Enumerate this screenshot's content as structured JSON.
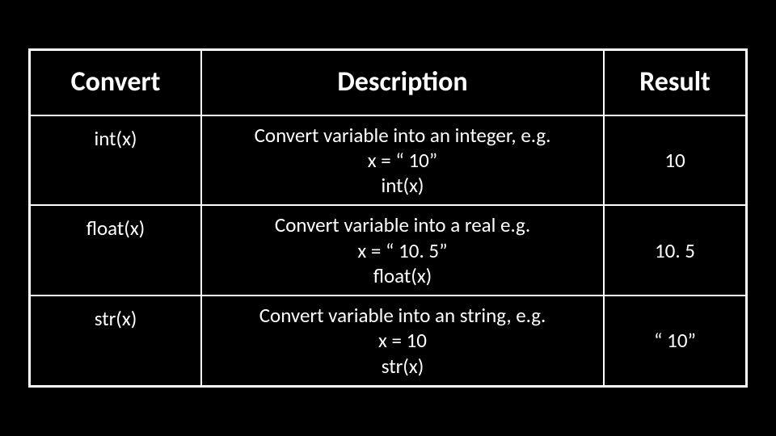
{
  "columns": {
    "convert": "Convert",
    "description": "Description",
    "result": "Result"
  },
  "rows": [
    {
      "convert": "int(x)",
      "desc_l1": "Convert variable into an integer, e.g.",
      "desc_l2": "x = “ 10”",
      "desc_l3": "int(x)",
      "result": "10"
    },
    {
      "convert": "float(x)",
      "desc_l1": "Convert variable into a real e.g.",
      "desc_l2": "x = “ 10. 5”",
      "desc_l3": "float(x)",
      "result": "10. 5"
    },
    {
      "convert": "str(x)",
      "desc_l1": "Convert variable into an string, e.g.",
      "desc_l2": "x = 10",
      "desc_l3": "str(x)",
      "result": "“ 10”"
    }
  ]
}
